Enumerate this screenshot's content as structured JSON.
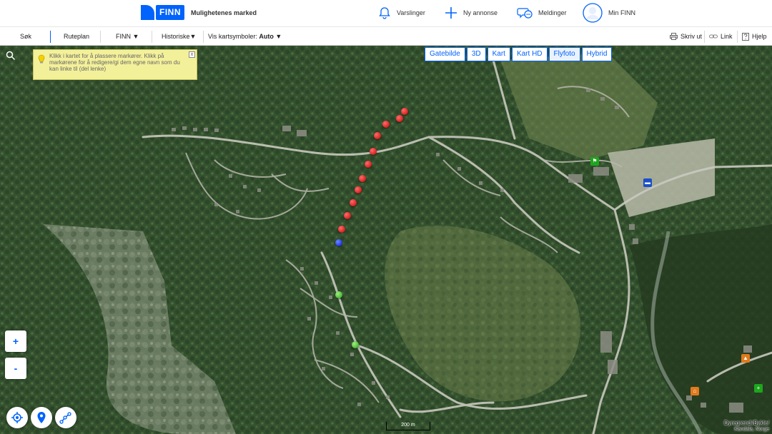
{
  "header": {
    "logo_text": "FINN",
    "tagline": "Mulighetenes marked",
    "nav": [
      {
        "label": "Varslinger",
        "icon": "bell-icon"
      },
      {
        "label": "Ny annonse",
        "icon": "plus-icon"
      },
      {
        "label": "Meldinger",
        "icon": "chat-icon"
      },
      {
        "label": "Min FINN",
        "icon": "user-icon"
      }
    ]
  },
  "toolbar": {
    "left": [
      {
        "label": "Søk"
      },
      {
        "label": "Ruteplan"
      },
      {
        "label": "FINN ▼"
      },
      {
        "label": "Historiske▼"
      }
    ],
    "symbols_label": "Vis kartsymboler: ",
    "symbols_value": "Auto ▼",
    "right": [
      {
        "label": "Skriv ut",
        "icon": "printer-icon"
      },
      {
        "label": "Link",
        "icon": "link-icon"
      },
      {
        "label": "Hjelp",
        "icon": "help-icon"
      }
    ]
  },
  "map": {
    "tip_text": "Klikk i kartet for å plassere markører. Klikk på markørene for å redigere/gi dem egne navn som du kan linke til (del lenke)",
    "tip_close": "x",
    "map_types": [
      {
        "label": "Gatebilde",
        "selected": false
      },
      {
        "label": "3D",
        "selected": false
      },
      {
        "label": "Kart",
        "selected": false
      },
      {
        "label": "Kart HD",
        "selected": false
      },
      {
        "label": "Flyfoto",
        "selected": true
      },
      {
        "label": "Hybrid",
        "selected": false
      }
    ],
    "zoom_in": "+",
    "zoom_out": "-",
    "scale_label": "200 m",
    "attribution_main": "Dyregrendi/Bykle/",
    "attribution_sub": "Kandala, Norge",
    "colors": {
      "accent": "#0063fb",
      "marker_red": "#d40000",
      "marker_blue": "#0010c8",
      "marker_green": "#3cb82a"
    }
  }
}
